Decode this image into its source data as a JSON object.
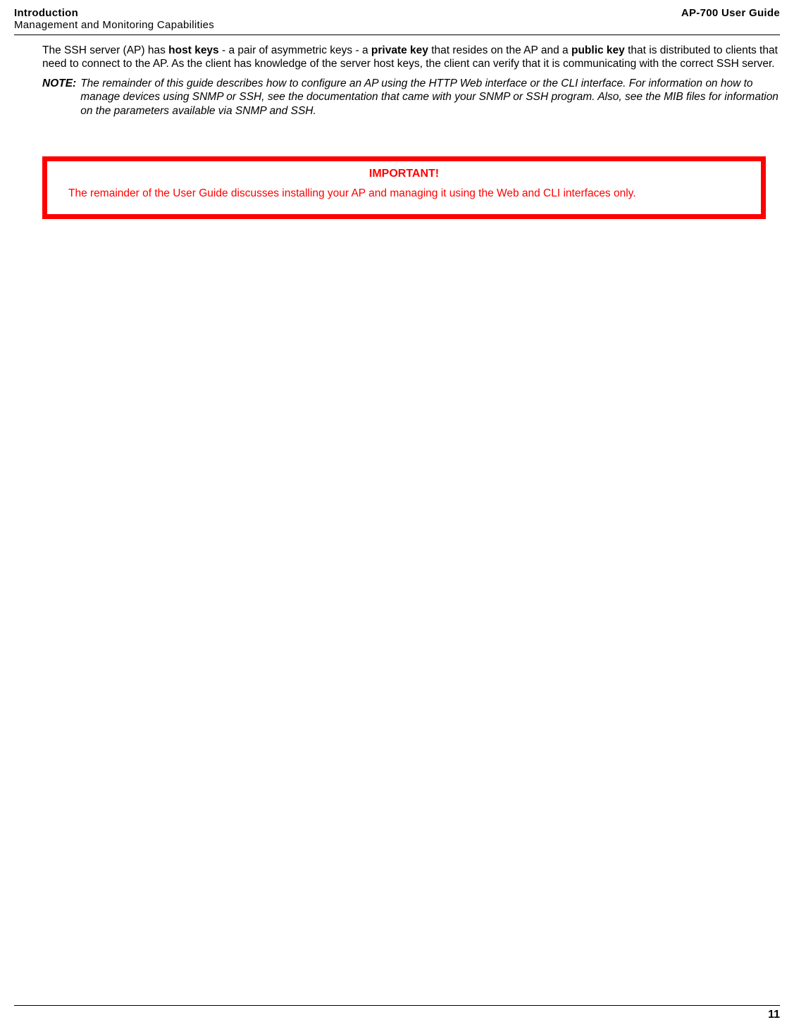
{
  "header": {
    "titleLeft": "Introduction",
    "subtitleLeft": "Management and Monitoring Capabilities",
    "titleRight": "AP-700 User Guide"
  },
  "text": {
    "p1_a": "The SSH server (AP) has ",
    "p1_b": "host keys",
    "p1_c": " - a pair of asymmetric keys - a ",
    "p1_d": "private key",
    "p1_e": " that resides on the AP and a ",
    "p1_f": "public key",
    "p1_g": " that is distributed to clients that need to connect to the AP. As the client has knowledge of the server host keys, the client can verify that it is communicating with the correct SSH server."
  },
  "note": {
    "label": "NOTE:",
    "body": "The remainder of this guide describes how to configure an AP using the HTTP Web interface or the CLI interface. For information on how to manage devices using SNMP or SSH, see the documentation that came with your SNMP or SSH program. Also, see the MIB files for information on the parameters available via SNMP and SSH."
  },
  "important": {
    "title": "IMPORTANT!",
    "body": "The remainder of the User Guide discusses installing your AP and managing it using the Web and CLI interfaces only."
  },
  "pageNumber": "11"
}
